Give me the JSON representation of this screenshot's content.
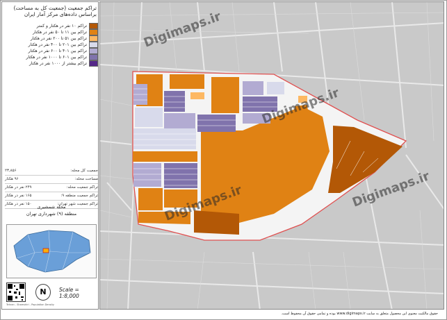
{
  "title": {
    "line1": "تراکم جمعیت (جمعیت کل به مساحت)",
    "line2": "براساس داده‌های مرکز آمار ایران"
  },
  "legend": [
    {
      "label": "تراکم ۱۰ نفر در هکتار و کمتر",
      "color": "#b35806"
    },
    {
      "label": "تراکم بین ۱۱ تا ۵۰ نفر در هکتار",
      "color": "#e08214"
    },
    {
      "label": "تراکم بین ۵۱ تا ۲۰۰ نفر در هکتار",
      "color": "#fdb863"
    },
    {
      "label": "تراکم بین ۲۰۱ تا ۴۰۰ نفر در هکتار",
      "color": "#d8daeb"
    },
    {
      "label": "تراکم بین ۴۰۱ تا ۶۰۰ نفر در هکتار",
      "color": "#b2abd2"
    },
    {
      "label": "تراکم بین ۶۰۱ تا ۱۰۰۰ نفر در هکتار",
      "color": "#8073ac"
    },
    {
      "label": "تراکم بیشتر از ۱۰۰۰ نفر در هکتار",
      "color": "#542788"
    }
  ],
  "stats": [
    {
      "label": "جمعیت کل محله:",
      "value": "۲۳,۸۵۶"
    },
    {
      "label": "مساحت محله:",
      "value": "۹۶ هکتار"
    },
    {
      "label": "تراکم جمعیت محله:",
      "value": "۲۴۹ نفر در هکتار"
    },
    {
      "label": "تراکم جمعیت منطقه ۹:",
      "value": "۱۶۵ نفر در هکتار"
    },
    {
      "label": "تراکم جمعیت شهر تهران:",
      "value": "۱۵۰ نفر در هکتار"
    }
  ],
  "location": {
    "neighborhood": "محله شمشیری",
    "district": "منطقه (۹) شهرداری تهران"
  },
  "north_label": "N",
  "scale": "Scale = 1:8,000",
  "credit_small": "Tehran - Shamshiri - Population Density",
  "footer": "حقوق مالکیت معنوی این محصول متعلق به سایت www.digimaps.ir بوده و تمامی حقوق آن محفوظ است.",
  "watermark": "Digimaps.ir",
  "colors": {
    "street_bg": "#cfcfcf",
    "block_outline": "#e05050",
    "road_fill": "#f2f2f2"
  }
}
